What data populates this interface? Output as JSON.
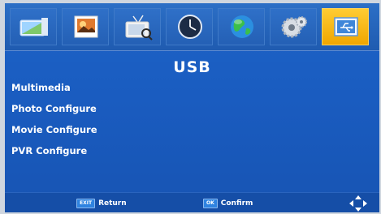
{
  "tabs": [
    {
      "icon": "picture-icon"
    },
    {
      "icon": "image-icon"
    },
    {
      "icon": "channel-tv-icon"
    },
    {
      "icon": "clock-icon"
    },
    {
      "icon": "globe-icon"
    },
    {
      "icon": "gears-icon"
    },
    {
      "icon": "usb-icon",
      "active": true
    }
  ],
  "page": {
    "title": "USB"
  },
  "menu": {
    "items": [
      {
        "label": "Multimedia"
      },
      {
        "label": "Photo Configure"
      },
      {
        "label": "Movie Configure"
      },
      {
        "label": "PVR Configure"
      }
    ]
  },
  "bottom": {
    "return_key": "EXIT",
    "return_label": "Return",
    "confirm_key": "OK",
    "confirm_label": "Confirm",
    "nav_icon": "navigation-arrows-icon"
  },
  "colors": {
    "accent": "#f0a600",
    "background": "#1a5cc0"
  }
}
